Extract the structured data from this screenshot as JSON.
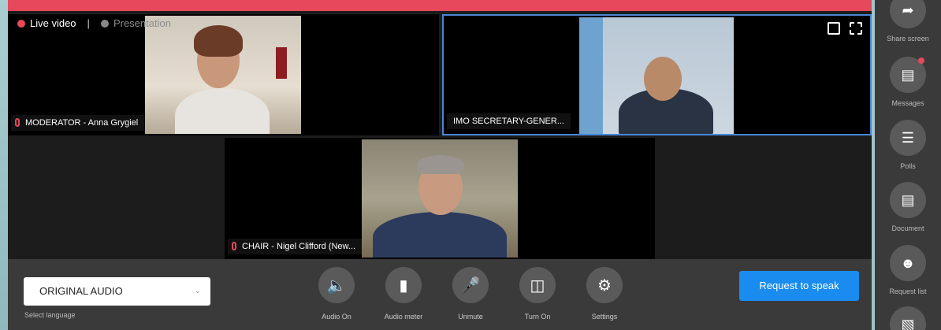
{
  "live": {
    "live_label": "Live video",
    "separator": "|",
    "presentation_label": "Presentation"
  },
  "tiles": [
    {
      "caption": "MODERATOR - Anna Grygiel"
    },
    {
      "caption": "IMO SECRETARY-GENER..."
    },
    {
      "caption": "CHAIR - Nigel Clifford (New..."
    }
  ],
  "controls": {
    "language_value": "ORIGINAL AUDIO",
    "language_label": "Select language",
    "audio_on": "Audio On",
    "audio_meter": "Audio meter",
    "unmute": "Unmute",
    "turn_on": "Turn On",
    "settings": "Settings",
    "request": "Request to speak"
  },
  "sidebar": {
    "share_screen": "Share screen",
    "messages": "Messages",
    "polls": "Polls",
    "document": "Document",
    "request_list": "Request list"
  },
  "colors": {
    "accent": "#e8485c",
    "primary": "#1a8cf0",
    "panel": "#3a3a3a"
  }
}
